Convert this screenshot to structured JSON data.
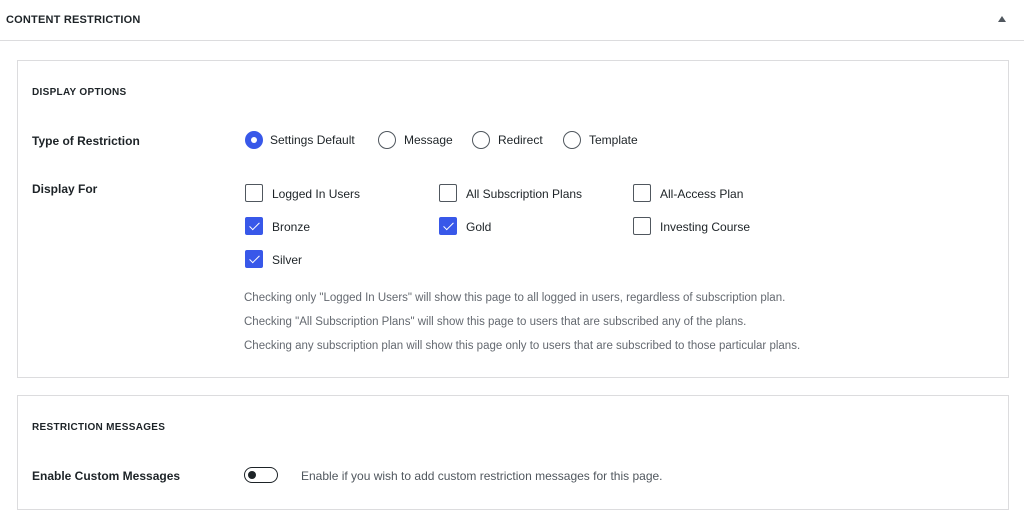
{
  "metabox": {
    "title": "CONTENT RESTRICTION",
    "collapse_icon": "triangle-up-icon"
  },
  "display_options": {
    "title": "DISPLAY OPTIONS",
    "type_of_restriction": {
      "label": "Type of Restriction",
      "options": [
        {
          "label": "Settings Default",
          "checked": true
        },
        {
          "label": "Message",
          "checked": false
        },
        {
          "label": "Redirect",
          "checked": false
        },
        {
          "label": "Template",
          "checked": false
        }
      ]
    },
    "display_for": {
      "label": "Display For",
      "options": [
        {
          "label": "Logged In Users",
          "checked": false
        },
        {
          "label": "All Subscription Plans",
          "checked": false
        },
        {
          "label": "All-Access Plan",
          "checked": false
        },
        {
          "label": "Bronze",
          "checked": true
        },
        {
          "label": "Gold",
          "checked": true
        },
        {
          "label": "Investing Course",
          "checked": false
        },
        {
          "label": "Silver",
          "checked": true
        }
      ]
    },
    "help": [
      "Checking only \"Logged In Users\" will show this page to all logged in users, regardless of subscription plan.",
      "Checking \"All Subscription Plans\" will show this page to users that are subscribed any of the plans.",
      "Checking any subscription plan will show this page only to users that are subscribed to those particular plans."
    ]
  },
  "restriction_messages": {
    "title": "RESTRICTION MESSAGES",
    "enable_custom": {
      "label": "Enable Custom Messages",
      "enabled": false,
      "description": "Enable if you wish to add custom restriction messages for this page."
    }
  },
  "colors": {
    "accent": "#3858e9",
    "border": "#dcdcde",
    "text": "#1d2327",
    "muted": "#646970"
  }
}
